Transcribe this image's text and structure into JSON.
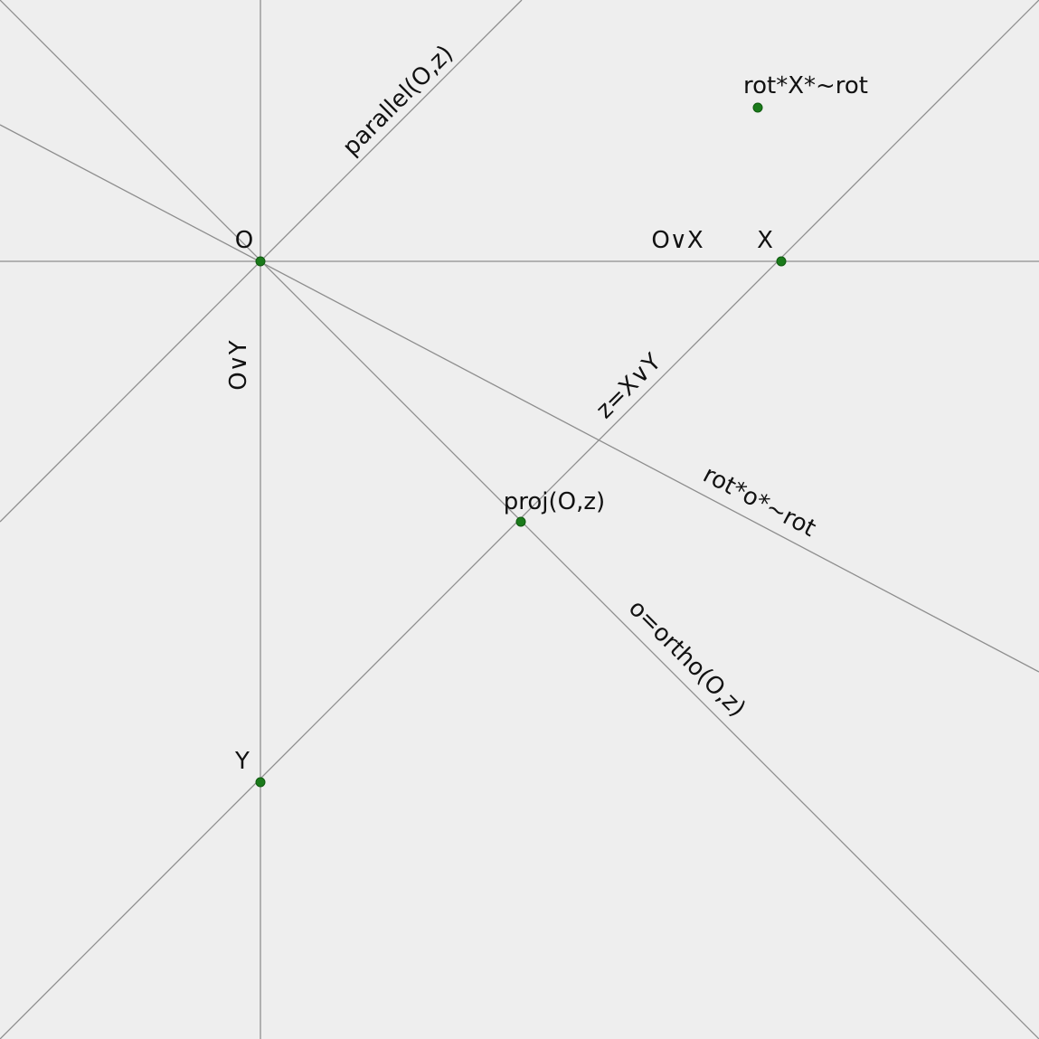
{
  "diagram": {
    "colors": {
      "background": "#eeeeee",
      "line": "#8e8e8e",
      "point": "#1a7a1a",
      "text": "#111111"
    },
    "labels": {
      "O": "O",
      "X": "X",
      "Y": "Y",
      "proj": "proj(O,z)",
      "rot_point": "rot*X*~rot",
      "line_OX": "O∨X",
      "line_OY": "O∨Y",
      "line_z": "z=X∨Y",
      "line_parallel": "parallel(O,z)",
      "line_ortho": "o=ortho(O,z)",
      "line_rot": "rot*o*~rot"
    }
  }
}
